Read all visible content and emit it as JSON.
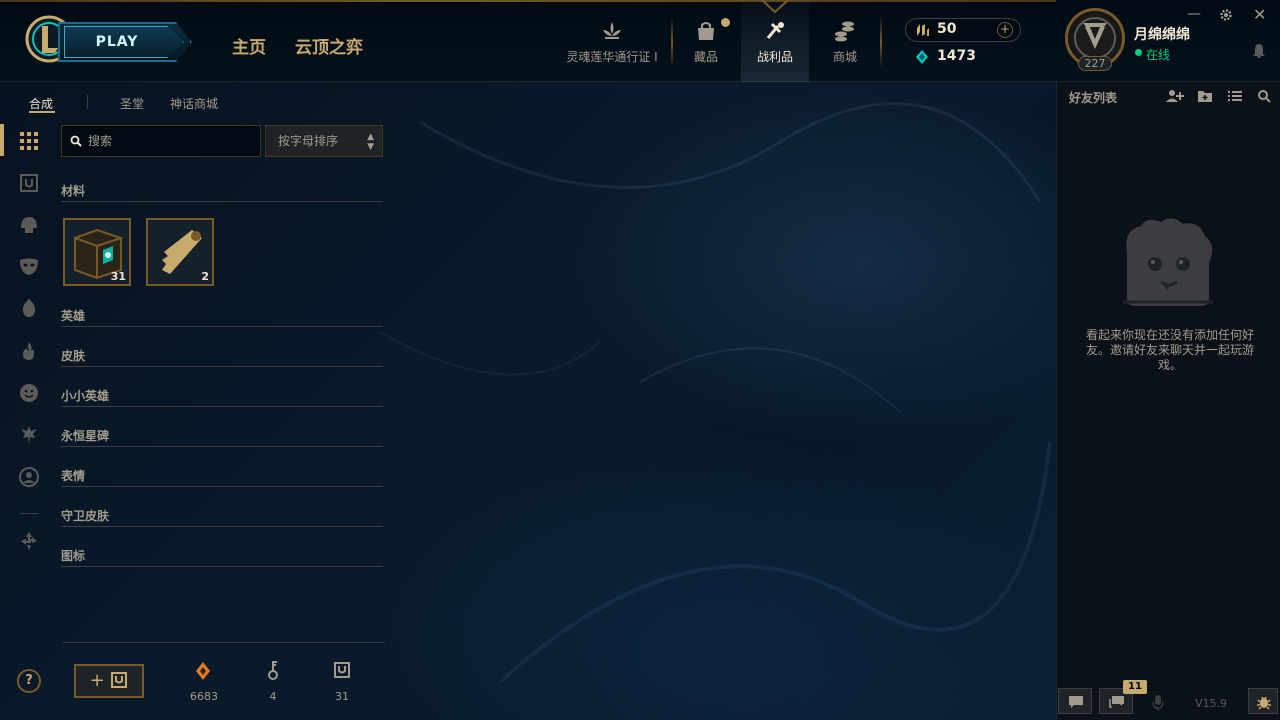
{
  "topbar": {
    "play_label": "PLAY",
    "nav_home": "主页",
    "nav_tft": "云顶之弈",
    "pass_label": "灵魂莲华通行证 I",
    "collection_label": "藏品",
    "loot_label": "战利品",
    "store_label": "商城",
    "rp_amount": "50",
    "be_amount": "1473",
    "profile": {
      "name": "月绵绵绵",
      "status": "在线",
      "level": "227"
    }
  },
  "subnav": {
    "tabs": [
      "合成",
      "圣堂",
      "神话商城"
    ],
    "active_tab": "合成"
  },
  "search": {
    "placeholder": "搜索",
    "sort_label": "按字母排序"
  },
  "categories": {
    "materials": "材料",
    "champions": "英雄",
    "skins": "皮肤",
    "little_legends": "小小英雄",
    "eternals": "永恒星碑",
    "emotes": "表情",
    "ward_skins": "守卫皮肤",
    "icons": "图标"
  },
  "materials": {
    "chest_count": "31",
    "key_count": "2"
  },
  "bottom": {
    "craft_label": "+",
    "orange_essence": "6683",
    "key_fragments": "4",
    "chests": "31",
    "help": "?"
  },
  "friends": {
    "title": "好友列表",
    "empty_text": "看起来你现在还没有添加任何好友。邀请好友来聊天并一起玩游戏。",
    "notif_count": "11",
    "version": "V15.9"
  },
  "colors": {
    "gold": "#c8aa6e",
    "gold_dark": "#785a28",
    "text": "#a09b8c",
    "online": "#0acf83",
    "blue": "#0ac8b9"
  }
}
